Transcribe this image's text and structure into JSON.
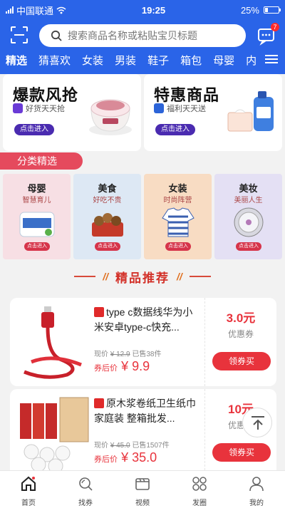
{
  "status_bar": {
    "carrier": "中国联通",
    "time": "19:25",
    "battery": "25%"
  },
  "header": {
    "search_placeholder": "搜索商品名称或粘贴宝贝标题",
    "message_badge": "7",
    "tabs": [
      "精选",
      "猜喜欢",
      "女装",
      "男装",
      "鞋子",
      "箱包",
      "母婴",
      "内"
    ]
  },
  "promos": [
    {
      "title": "爆款风抢",
      "subtitle": "好货天天抢",
      "button": "点击进入"
    },
    {
      "title": "特惠商品",
      "subtitle": "福利天天送",
      "button": "点击进入"
    }
  ],
  "category_section": {
    "title": "分类精选",
    "items": [
      {
        "name": "母婴",
        "sub": "智慧育儿",
        "button": "点击进入",
        "color": "#f7dfe4"
      },
      {
        "name": "美食",
        "sub": "好吃不贵",
        "button": "点击进入",
        "color": "#dde8f4"
      },
      {
        "name": "女装",
        "sub": "时尚阵营",
        "button": "点击进入",
        "color": "#f8dcc3"
      },
      {
        "name": "美妆",
        "sub": "美丽人生",
        "button": "点击进入",
        "color": "#e4e0f4"
      }
    ]
  },
  "recommend": {
    "title": "精品推荐"
  },
  "products": [
    {
      "title": "type c数据线华为小米安卓type-c快充...",
      "original_label": "现价",
      "original_price": "¥ 12.9",
      "sold": "已售38件",
      "after_label": "券后价",
      "price": "¥ 9.9",
      "coupon_value": "3.0元",
      "coupon_label": "优惠券",
      "coupon_button": "领券买"
    },
    {
      "title": "原木浆卷纸卫生纸巾家庭装 整箱批发...",
      "original_label": "现价",
      "original_price": "¥ 45.0",
      "sold": "已售1507件",
      "after_label": "券后价",
      "price": "¥ 35.0",
      "coupon_value": "10元",
      "coupon_label": "优惠券",
      "coupon_button": "领券买"
    }
  ],
  "bottom_nav": [
    "首页",
    "找券",
    "视频",
    "发圈",
    "我的"
  ],
  "colors": {
    "brand_blue": "#2a64e8",
    "accent_red": "#e8333c"
  }
}
